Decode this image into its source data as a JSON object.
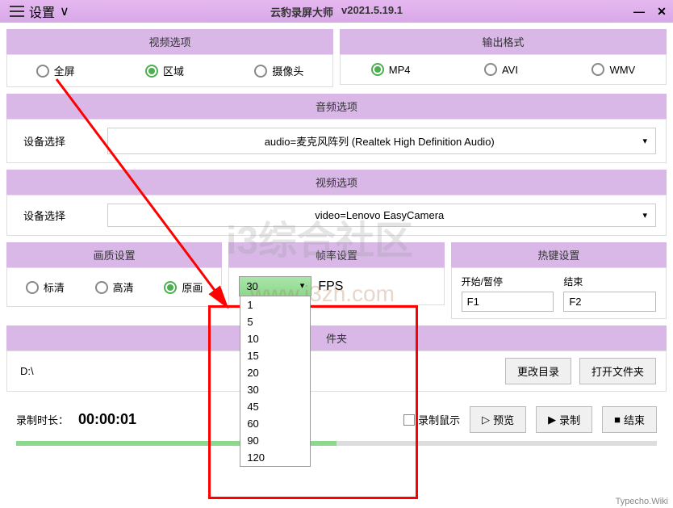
{
  "title_bar": {
    "settings_label": "设置",
    "app_title": "云豹录屏大师",
    "version": "v2021.5.19.1"
  },
  "video_options": {
    "header": "视频选项",
    "radios": {
      "fullscreen": "全屏",
      "region": "区域",
      "camera": "摄像头"
    }
  },
  "output_format": {
    "header": "输出格式",
    "radios": {
      "mp4": "MP4",
      "avi": "AVI",
      "wmv": "WMV"
    }
  },
  "audio_options": {
    "header": "音频选项",
    "device_label": "设备选择",
    "device_value": "audio=麦克风阵列 (Realtek High Definition Audio)"
  },
  "video_options2": {
    "header": "视频选项",
    "device_label": "设备选择",
    "device_value": "video=Lenovo EasyCamera"
  },
  "quality": {
    "header": "画质设置",
    "radios": {
      "sd": "标清",
      "hd": "高清",
      "orig": "原画"
    }
  },
  "fps": {
    "header": "帧率设置",
    "selected": "30",
    "unit": "FPS",
    "options": [
      "1",
      "5",
      "10",
      "15",
      "20",
      "30",
      "45",
      "60",
      "90",
      "120"
    ]
  },
  "hotkey": {
    "header": "热键设置",
    "start_pause_label": "开始/暂停",
    "start_pause_value": "F1",
    "end_label": "结束",
    "end_value": "F2"
  },
  "folder": {
    "header": "件夹",
    "path": "D:\\",
    "change_btn": "更改目录",
    "open_btn": "打开文件夹"
  },
  "bottom": {
    "timer_label": "录制时长：",
    "timer_value": "00:00:01",
    "record_mouse": "录制鼠示",
    "preview_btn": "预览",
    "record_btn": "录制",
    "end_btn": "结束"
  },
  "watermark": {
    "main": "i3综合社区",
    "sub": "www.i3zh.com"
  },
  "credit": "Typecho.Wiki"
}
